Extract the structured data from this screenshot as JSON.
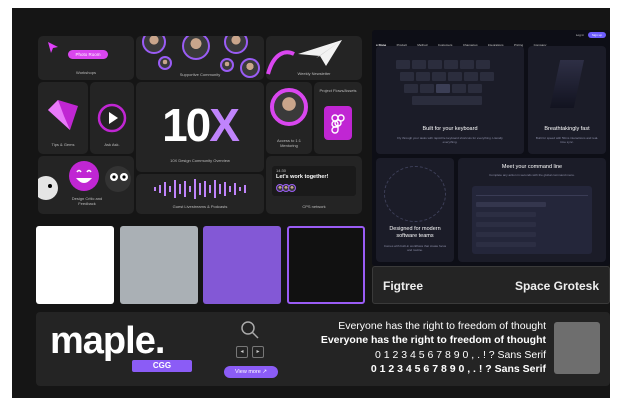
{
  "moodboard": {
    "tiles": {
      "workshops": {
        "pill": "Photo Room",
        "caption": "Workshops"
      },
      "community": {
        "caption": "Supportive Community"
      },
      "newsletter": {
        "caption": "Weekly Newsletter"
      },
      "tips": {
        "caption": "Tips & Gems"
      },
      "ask": {
        "caption": "Ask Ask."
      },
      "tenx": {
        "headline": "10X",
        "caption": "10X Design Community Overview"
      },
      "access": {
        "caption": "Access to 1:1 Mentoring"
      },
      "figma": {
        "caption": "Project Flows/Assets"
      },
      "design_critic": {
        "caption": "Design Critic and Feedback"
      },
      "guest": {
        "caption": "Guest Livestreams & Podcasts"
      },
      "chat": {
        "time": "14:30",
        "message": "Let's work together!",
        "caption": "CPS network"
      }
    },
    "swatches": [
      "#ffffff",
      "#aab0b5",
      "#8358d6",
      "#111111"
    ],
    "website": {
      "nav_brand": "● Done",
      "nav_links": [
        "Product",
        "Method",
        "Customers",
        "Changelog",
        "Integrations",
        "Pricing",
        "Company"
      ],
      "nav_login": "Log in",
      "nav_signup": "Sign up",
      "keyboard_title": "Built for your keyboard",
      "keyboard_sub": "Fly through your tasks with rapid-fire keyboard shortcuts for everything. Literally everything.",
      "fast_title": "Breathtakingly fast",
      "fast_sub": "Built for speed with 50ms interactions and real-time sync.",
      "command_title": "Meet your command line",
      "command_sub": "Complete any action in seconds with the global command menu.",
      "teams_title": "Designed for modern software teams",
      "teams_sub": "Comes with built-in workflows that create focus and routine."
    },
    "fonts": {
      "primary": "Figtree",
      "secondary": "Space Grotesk"
    },
    "brand": {
      "logo": "maple.",
      "logo_badge": "CGG",
      "view_more": "View more ↗",
      "sample1": "Everyone has the right to freedom of thought",
      "sample2": "Everyone has the right to freedom of thought",
      "digits1": "0 1 2 3 4 5 6 7 8 9 0 , . ! ? Sans Serif",
      "digits2": "0 1 2 3 4 5 6 7 8 9 0 , . ! ? Sans Serif"
    },
    "colors": {
      "accent": "#8b5cf6",
      "pink": "#e040fb",
      "panel": "#242424",
      "board": "#151515"
    },
    "icons": [
      "play-icon",
      "search-icon",
      "paper-plane-icon",
      "figma-icon",
      "emoji-icon",
      "arrow-left-icon",
      "arrow-right-icon"
    ]
  }
}
